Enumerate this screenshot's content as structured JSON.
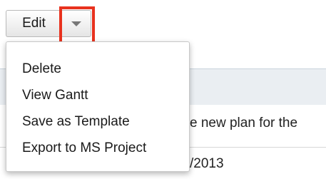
{
  "toolbar": {
    "edit_label": "Edit",
    "dropdown_icon": "caret-down-icon",
    "highlight_color": "#e8321e"
  },
  "menu": {
    "items": [
      {
        "label": "Delete"
      },
      {
        "label": "View Gantt"
      },
      {
        "label": "Save as Template"
      },
      {
        "label": "Export to MS Project"
      }
    ]
  },
  "background": {
    "description_fragment": "e new plan for the",
    "date_fragment": "/2013"
  }
}
